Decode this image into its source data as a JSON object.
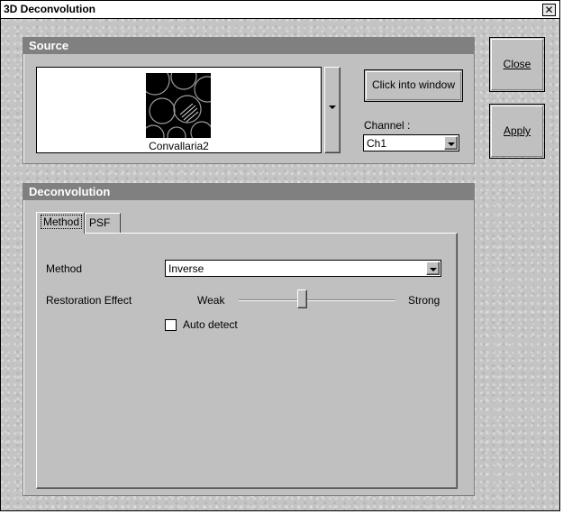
{
  "window": {
    "title": "3D Deconvolution",
    "close_glyph": "✕"
  },
  "source": {
    "header": "Source",
    "image_label": "Convallaria2",
    "image_icon": "convallaria-thumbnail",
    "click_into_window": "Click into window",
    "channel_label": "Channel :",
    "channel_value": "Ch1"
  },
  "side_buttons": {
    "close": "Close",
    "apply": "Apply"
  },
  "deconvolution": {
    "header": "Deconvolution",
    "tabs": [
      {
        "label": "Method"
      },
      {
        "label": "PSF"
      }
    ],
    "method_label": "Method",
    "method_value": "Inverse",
    "restoration_label": "Restoration Effect",
    "slider_min_label": "Weak",
    "slider_max_label": "Strong",
    "slider_level": 0.4,
    "auto_detect_label": "Auto detect",
    "auto_detect_checked": false
  }
}
